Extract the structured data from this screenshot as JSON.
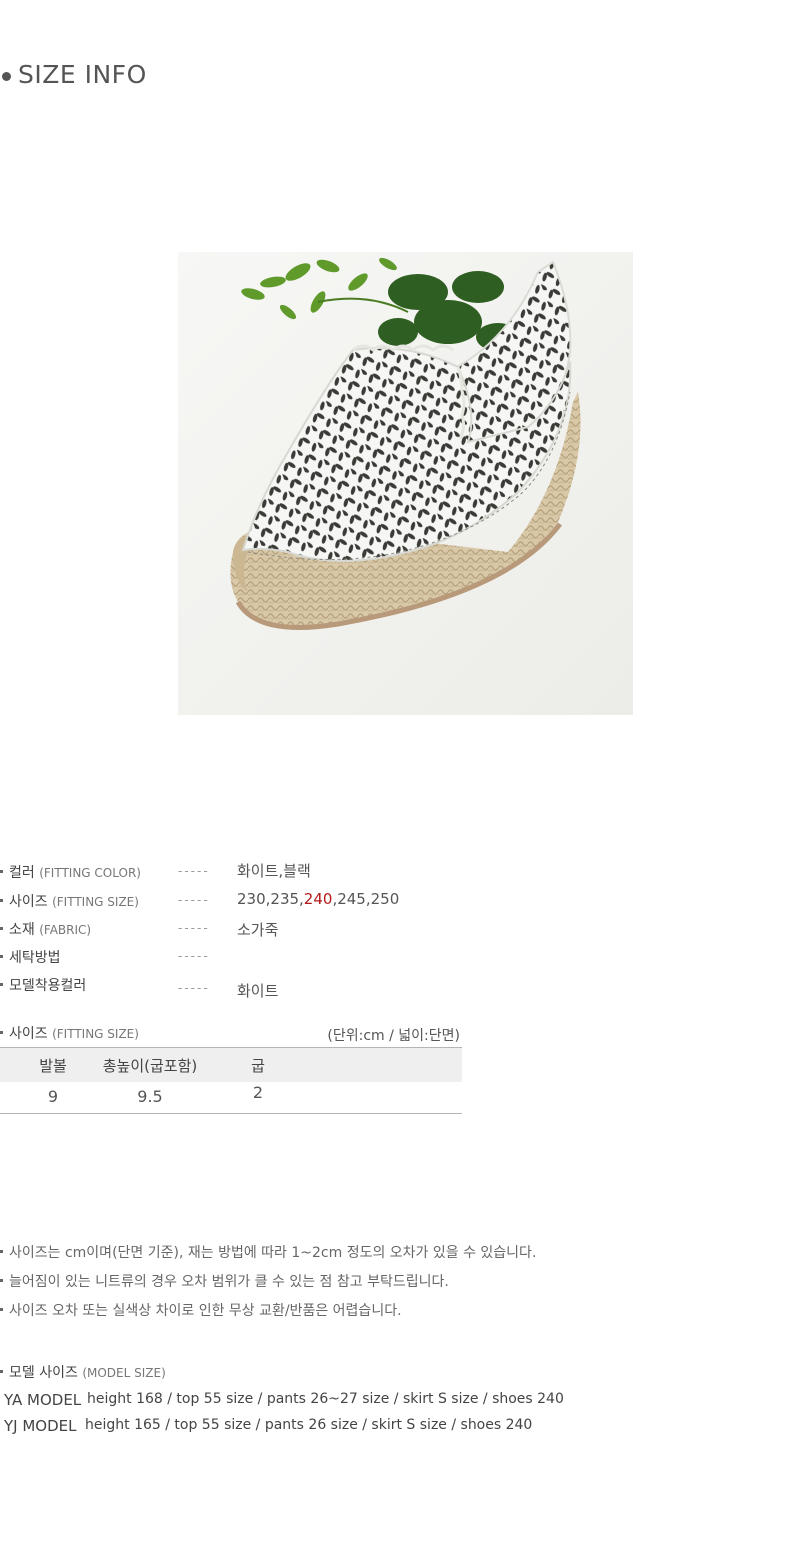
{
  "section_title": "SIZE INFO",
  "specs": [
    {
      "label": "컬러",
      "label_en": "(FITTING COLOR)",
      "dashes": "-----",
      "value": "화이트,블랙"
    },
    {
      "label": "사이즈",
      "label_en": "(FITTING SIZE)",
      "dashes": "-----",
      "value_before": "230,235,",
      "value_highlight": "240",
      "value_after": ",245,250"
    },
    {
      "label": "소재",
      "label_en": "(FABRIC)",
      "dashes": "-----",
      "value": "소가죽"
    },
    {
      "label": "세탁방법",
      "label_en": "",
      "dashes": "-----",
      "value": ""
    },
    {
      "label": "모델착용컬러",
      "label_en": "",
      "dashes": "-----",
      "value": "화이트"
    }
  ],
  "size_table": {
    "label": "사이즈",
    "label_en": "(FITTING SIZE)",
    "unit_note": "(단위:cm / 넓이:단면)",
    "headers": [
      "발볼",
      "총높이(굽포함)",
      "굽"
    ],
    "rows": [
      [
        "9",
        "9.5",
        "2"
      ]
    ]
  },
  "notes": [
    "사이즈는 cm이며(단면 기준), 재는 방법에 따라 1~2cm 정도의 오차가 있을 수 있습니다.",
    "늘어짐이 있는 니트류의 경우 오차 범위가 클 수 있는 점 참고 부탁드립니다.",
    "사이즈 오차 또는 실색상 차이로 인한 무상 교환/반품은 어렵습니다."
  ],
  "model_section": {
    "label": "모델 사이즈",
    "label_en": "(MODEL SIZE)",
    "models": [
      {
        "name": "YA MODEL",
        "info": "height 168 / top 55 size / pants 26~27 size / skirt S size / shoes 240"
      },
      {
        "name": "YJ MODEL",
        "info": "height 165 / top 55 size / pants 26 size / skirt S size / shoes 240"
      }
    ]
  },
  "colors": {
    "highlight": "#b31919",
    "table_header_bg": "#efefef",
    "text": "#444444"
  },
  "photo": {
    "subject": "white perforated leather espadrille shoe with jute sole and green plant"
  }
}
